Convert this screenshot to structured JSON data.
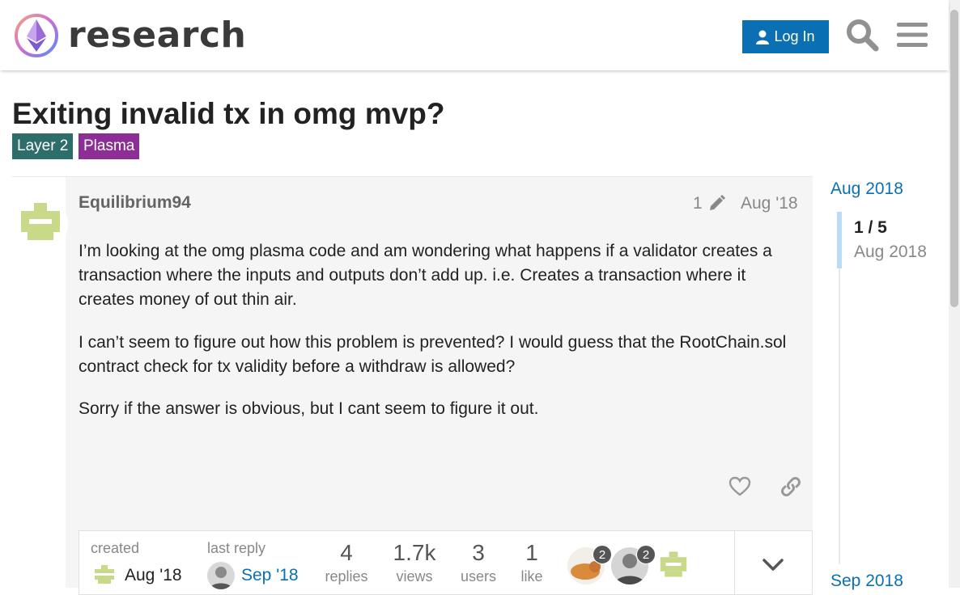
{
  "header": {
    "site_name": "research",
    "login_label": "Log In",
    "search_icon": "search-icon",
    "menu_icon": "hamburger-menu-icon"
  },
  "topic": {
    "title": "Exiting invalid tx in omg mvp?",
    "tags": [
      {
        "label": "Layer 2",
        "color": "#2e6e6a"
      },
      {
        "label": "Plasma",
        "color": "#8c2e96"
      }
    ]
  },
  "post": {
    "username": "Equilibrium94",
    "edit_count": "1",
    "date": "Aug '18",
    "paragraphs": [
      "I’m looking at the omg plasma code and am wondering what happens if a validator creates a transaction where the inputs and outputs don’t add up. i.e. Creates a transaction where it creates money of out thin air.",
      "I can’t seem to figure out how this problem is prevented? I would guess that the RootChain.sol contract check for tx validity before a withdraw is allowed?",
      "Sorry if the answer is obvious, but I cant seem to figure it out."
    ]
  },
  "topic_map": {
    "created_label": "created",
    "created_date": "Aug '18",
    "last_reply_label": "last reply",
    "last_reply_date": "Sep '18",
    "stats": [
      {
        "value": "4",
        "label": "replies"
      },
      {
        "value": "1.7k",
        "label": "views"
      },
      {
        "value": "3",
        "label": "users"
      },
      {
        "value": "1",
        "label": "like"
      }
    ],
    "participants": [
      {
        "count": "2"
      },
      {
        "count": "2"
      }
    ]
  },
  "timeline": {
    "start_label": "Aug 2018",
    "position": "1 / 5",
    "position_date": "Aug 2018",
    "end_label": "Sep 2018"
  },
  "colors": {
    "primary": "#0a70b3",
    "avatar_green": "#c8d98a"
  }
}
